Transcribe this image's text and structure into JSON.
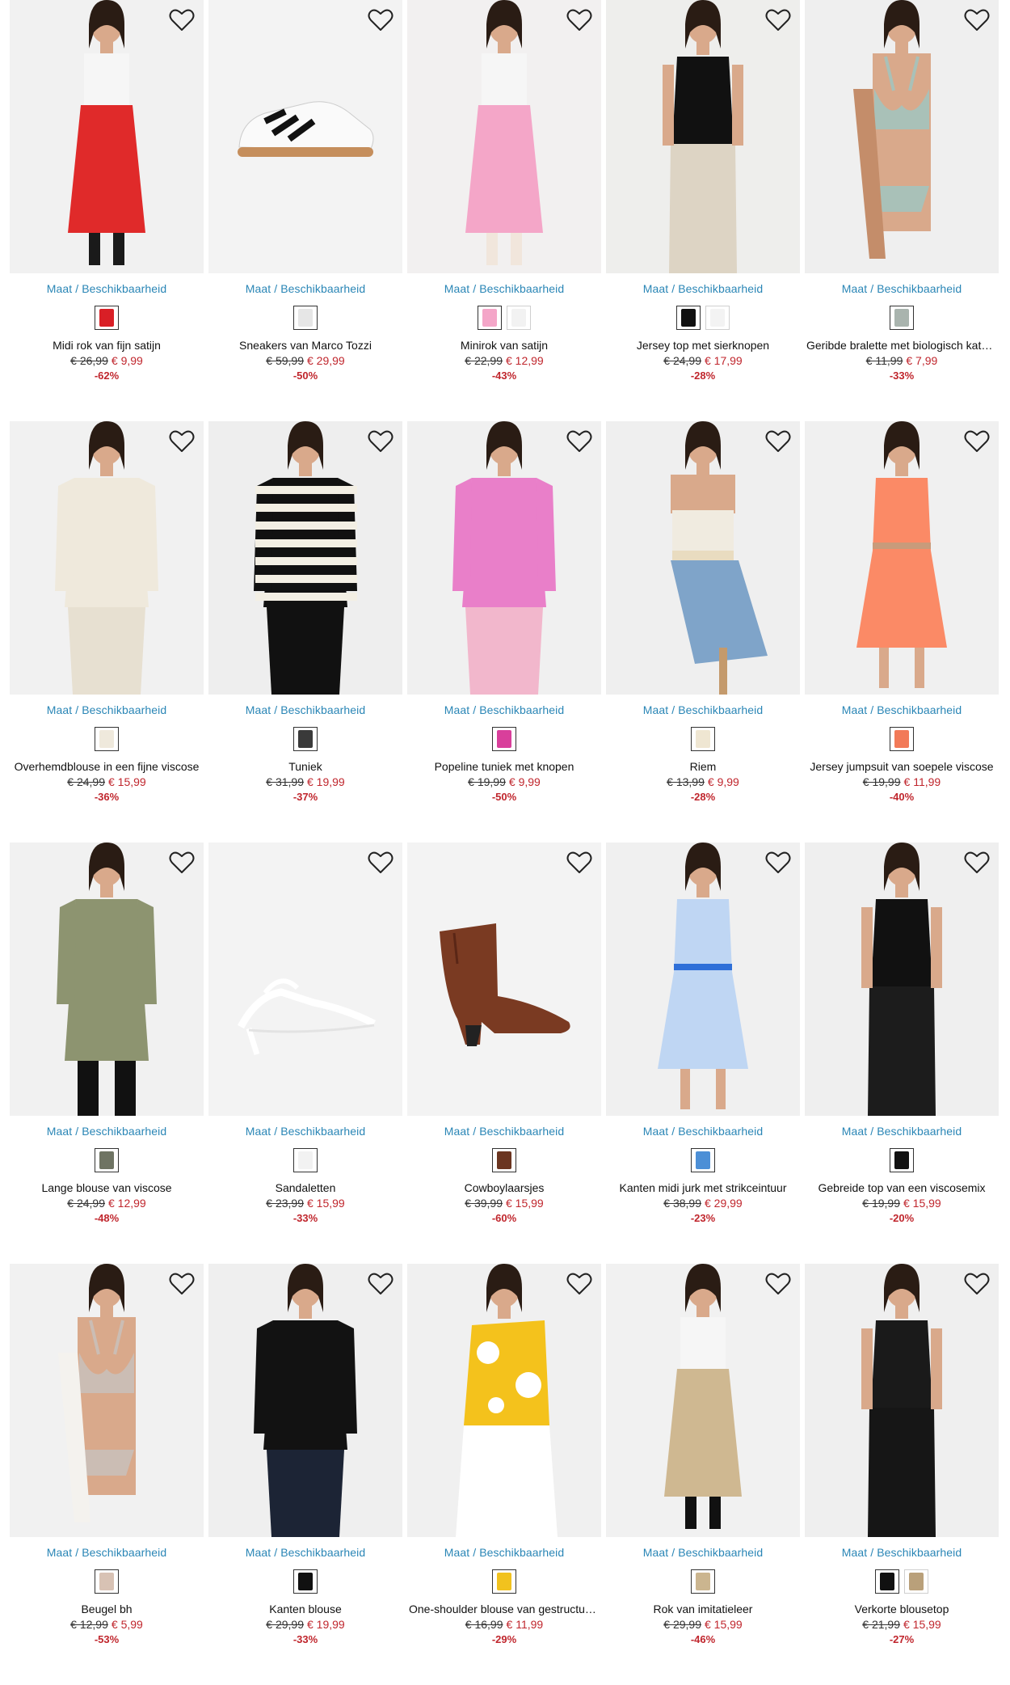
{
  "common": {
    "size_link": "Maat / Beschikbaarheid",
    "heart_icon": "heart-outline-icon"
  },
  "products": [
    {
      "name": "Midi rok van fijn satijn",
      "old": "€ 26,99",
      "new": "€ 9,99",
      "disc": "-62%",
      "bg": "#f1f1f1",
      "main": "#e02a2a",
      "accent": "#1a1a1a",
      "kind": "skirt",
      "swatches": [
        "#d91f26"
      ]
    },
    {
      "name": "Sneakers van Marco Tozzi",
      "old": "€ 59,99",
      "new": "€ 29,99",
      "disc": "-50%",
      "bg": "#f3f3f3",
      "main": "#ffffff",
      "accent": "#111111",
      "kind": "sneaker",
      "swatches": [
        "#e6e6e6"
      ]
    },
    {
      "name": "Minirok van satijn",
      "old": "€ 22,99",
      "new": "€ 12,99",
      "disc": "-43%",
      "bg": "#f2f0f0",
      "main": "#f4a6c8",
      "accent": "#f1e6dc",
      "kind": "skirt",
      "swatches": [
        "#f4a6c8",
        "#f2f2f2"
      ]
    },
    {
      "name": "Jersey top met sierknopen",
      "old": "€ 24,99",
      "new": "€ 17,99",
      "disc": "-28%",
      "bg": "#eeeeec",
      "main": "#111111",
      "accent": "#ddd4c4",
      "kind": "top",
      "swatches": [
        "#111111",
        "#f3f3f3"
      ]
    },
    {
      "name": "Geribde bralette met biologisch katoen",
      "old": "€ 11,99",
      "new": "€ 7,99",
      "disc": "-33%",
      "bg": "#efefef",
      "main": "#a9c1b8",
      "accent": "#c48d6a",
      "kind": "bra",
      "swatches": [
        "#a9b4ae"
      ]
    },
    {
      "name": "Overhemdblouse in een fijne viscose",
      "old": "€ 24,99",
      "new": "€ 15,99",
      "disc": "-36%",
      "bg": "#f1f1f1",
      "main": "#efe9dc",
      "accent": "#e7e0d1",
      "kind": "blouse",
      "swatches": [
        "#efe9dc"
      ]
    },
    {
      "name": "Tuniek",
      "old": "€ 31,99",
      "new": "€ 19,99",
      "disc": "-37%",
      "bg": "#eeeeee",
      "main": "#111111",
      "accent": "#f3efe4",
      "kind": "stripes",
      "swatches": [
        "#3a3a3a"
      ]
    },
    {
      "name": "Popeline tuniek met knopen",
      "old": "€ 19,99",
      "new": "€ 9,99",
      "disc": "-50%",
      "bg": "#f0f0f0",
      "main": "#e97fc9",
      "accent": "#f2b7cc",
      "kind": "blouse",
      "swatches": [
        "#d93f9b"
      ]
    },
    {
      "name": "Riem",
      "old": "€ 13,99",
      "new": "€ 9,99",
      "disc": "-28%",
      "bg": "#efefef",
      "main": "#f0ebe0",
      "accent": "#7fa4c9",
      "kind": "tube",
      "swatches": [
        "#efe6d2"
      ]
    },
    {
      "name": "Jersey jumpsuit van soepele viscose",
      "old": "€ 19,99",
      "new": "€ 11,99",
      "disc": "-40%",
      "bg": "#f0f0f0",
      "main": "#fb8a66",
      "accent": "#c89b7b",
      "kind": "dress",
      "swatches": [
        "#f27a58"
      ]
    },
    {
      "name": "Lange blouse van viscose",
      "old": "€ 24,99",
      "new": "€ 12,99",
      "disc": "-48%",
      "bg": "#f1f1f1",
      "main": "#8d9470",
      "accent": "#111111",
      "kind": "tunic",
      "swatches": [
        "#6f7463"
      ]
    },
    {
      "name": "Sandaletten",
      "old": "€ 23,99",
      "new": "€ 15,99",
      "disc": "-33%",
      "bg": "#f3f3f3",
      "main": "#ffffff",
      "accent": "#dddddd",
      "kind": "sandal",
      "swatches": [
        "#f2f2f2"
      ]
    },
    {
      "name": "Cowboylaarsjes",
      "old": "€ 39,99",
      "new": "€ 15,99",
      "disc": "-60%",
      "bg": "#f3f3f3",
      "main": "#7a3a22",
      "accent": "#222222",
      "kind": "boot",
      "swatches": [
        "#6b3520"
      ]
    },
    {
      "name": "Kanten midi jurk met strikceintuur",
      "old": "€ 38,99",
      "new": "€ 29,99",
      "disc": "-23%",
      "bg": "#f0f0f0",
      "main": "#bfd6f3",
      "accent": "#2e6fd8",
      "kind": "dress",
      "swatches": [
        "#4c8fd6"
      ]
    },
    {
      "name": "Gebreide top van een viscosemix",
      "old": "€ 19,99",
      "new": "€ 15,99",
      "disc": "-20%",
      "bg": "#efefef",
      "main": "#111111",
      "accent": "#1c1c1c",
      "kind": "top",
      "swatches": [
        "#111111"
      ]
    },
    {
      "name": "Beugel bh",
      "old": "€ 12,99",
      "new": "€ 5,99",
      "disc": "-53%",
      "bg": "#f1f1f1",
      "main": "#cbbdb4",
      "accent": "#f4f2ee",
      "kind": "bra",
      "swatches": [
        "#d8c2b4"
      ]
    },
    {
      "name": "Kanten blouse",
      "old": "€ 29,99",
      "new": "€ 19,99",
      "disc": "-33%",
      "bg": "#efefef",
      "main": "#121212",
      "accent": "#1c2435",
      "kind": "blouse",
      "swatches": [
        "#111111"
      ]
    },
    {
      "name": "One-shoulder blouse van gestructureerde viscose",
      "old": "€ 16,99",
      "new": "€ 11,99",
      "disc": "-29%",
      "bg": "#f0f0f0",
      "main": "#f4c21c",
      "accent": "#ffffff",
      "kind": "oneshoulder",
      "swatches": [
        "#f1c21e"
      ]
    },
    {
      "name": "Rok van imitatieleer",
      "old": "€ 29,99",
      "new": "€ 15,99",
      "disc": "-46%",
      "bg": "#f1f1f1",
      "main": "#cfb891",
      "accent": "#111111",
      "kind": "skirt",
      "swatches": [
        "#cbb58f"
      ]
    },
    {
      "name": "Verkorte blousetop",
      "old": "€ 21,99",
      "new": "€ 15,99",
      "disc": "-27%",
      "bg": "#efefef",
      "main": "#1a1a1a",
      "accent": "#161616",
      "kind": "top",
      "swatches": [
        "#111111",
        "#b9a07a"
      ]
    }
  ]
}
